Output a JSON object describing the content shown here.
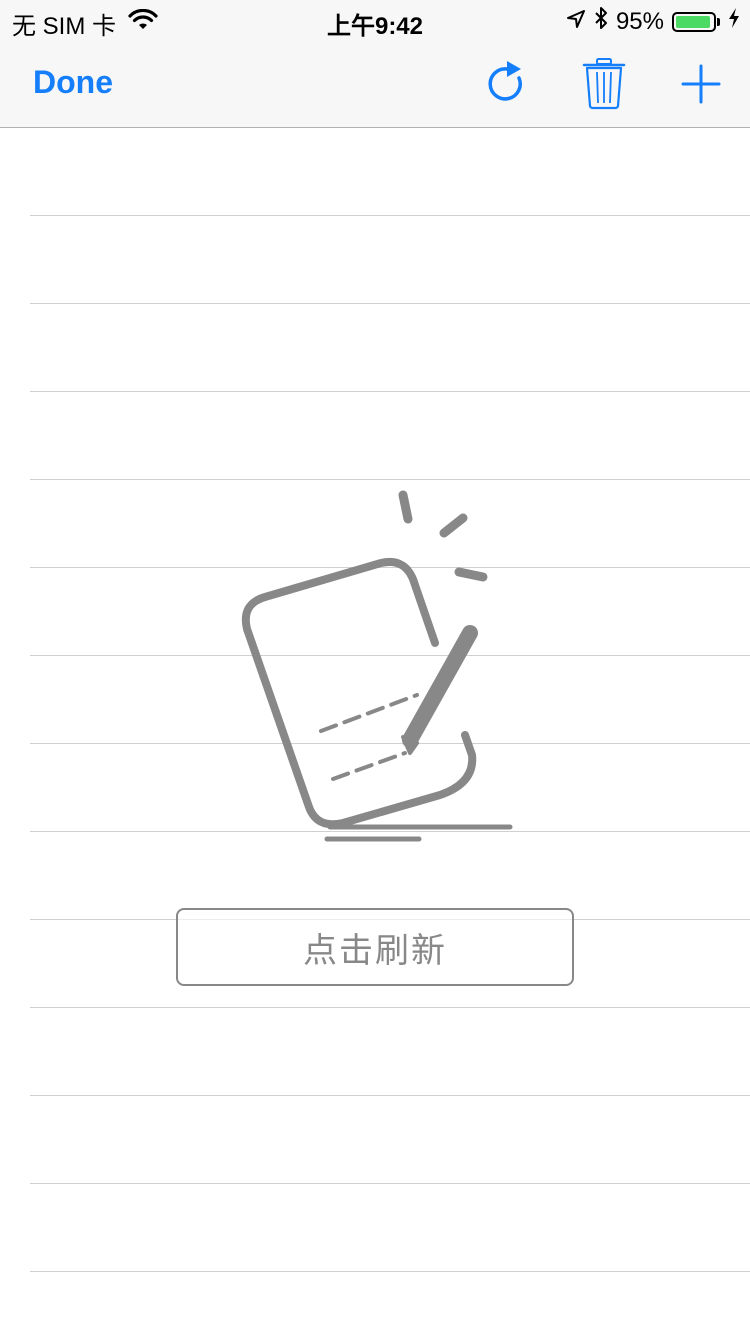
{
  "status_bar": {
    "carrier": "无 SIM 卡",
    "time": "上午9:42",
    "battery": "95%",
    "battery_level": 0.95,
    "icons": [
      "wifi-icon",
      "location-arrow-icon",
      "bluetooth-icon",
      "battery-icon",
      "charging-bolt-icon"
    ]
  },
  "nav": {
    "done_label": "Done",
    "icons": [
      "refresh-icon",
      "trash-icon",
      "plus-icon"
    ],
    "accent_color": "#147efb"
  },
  "empty_state": {
    "illustration": "note-edit-icon",
    "refresh_label": "点击刷新",
    "color": "#888888"
  }
}
